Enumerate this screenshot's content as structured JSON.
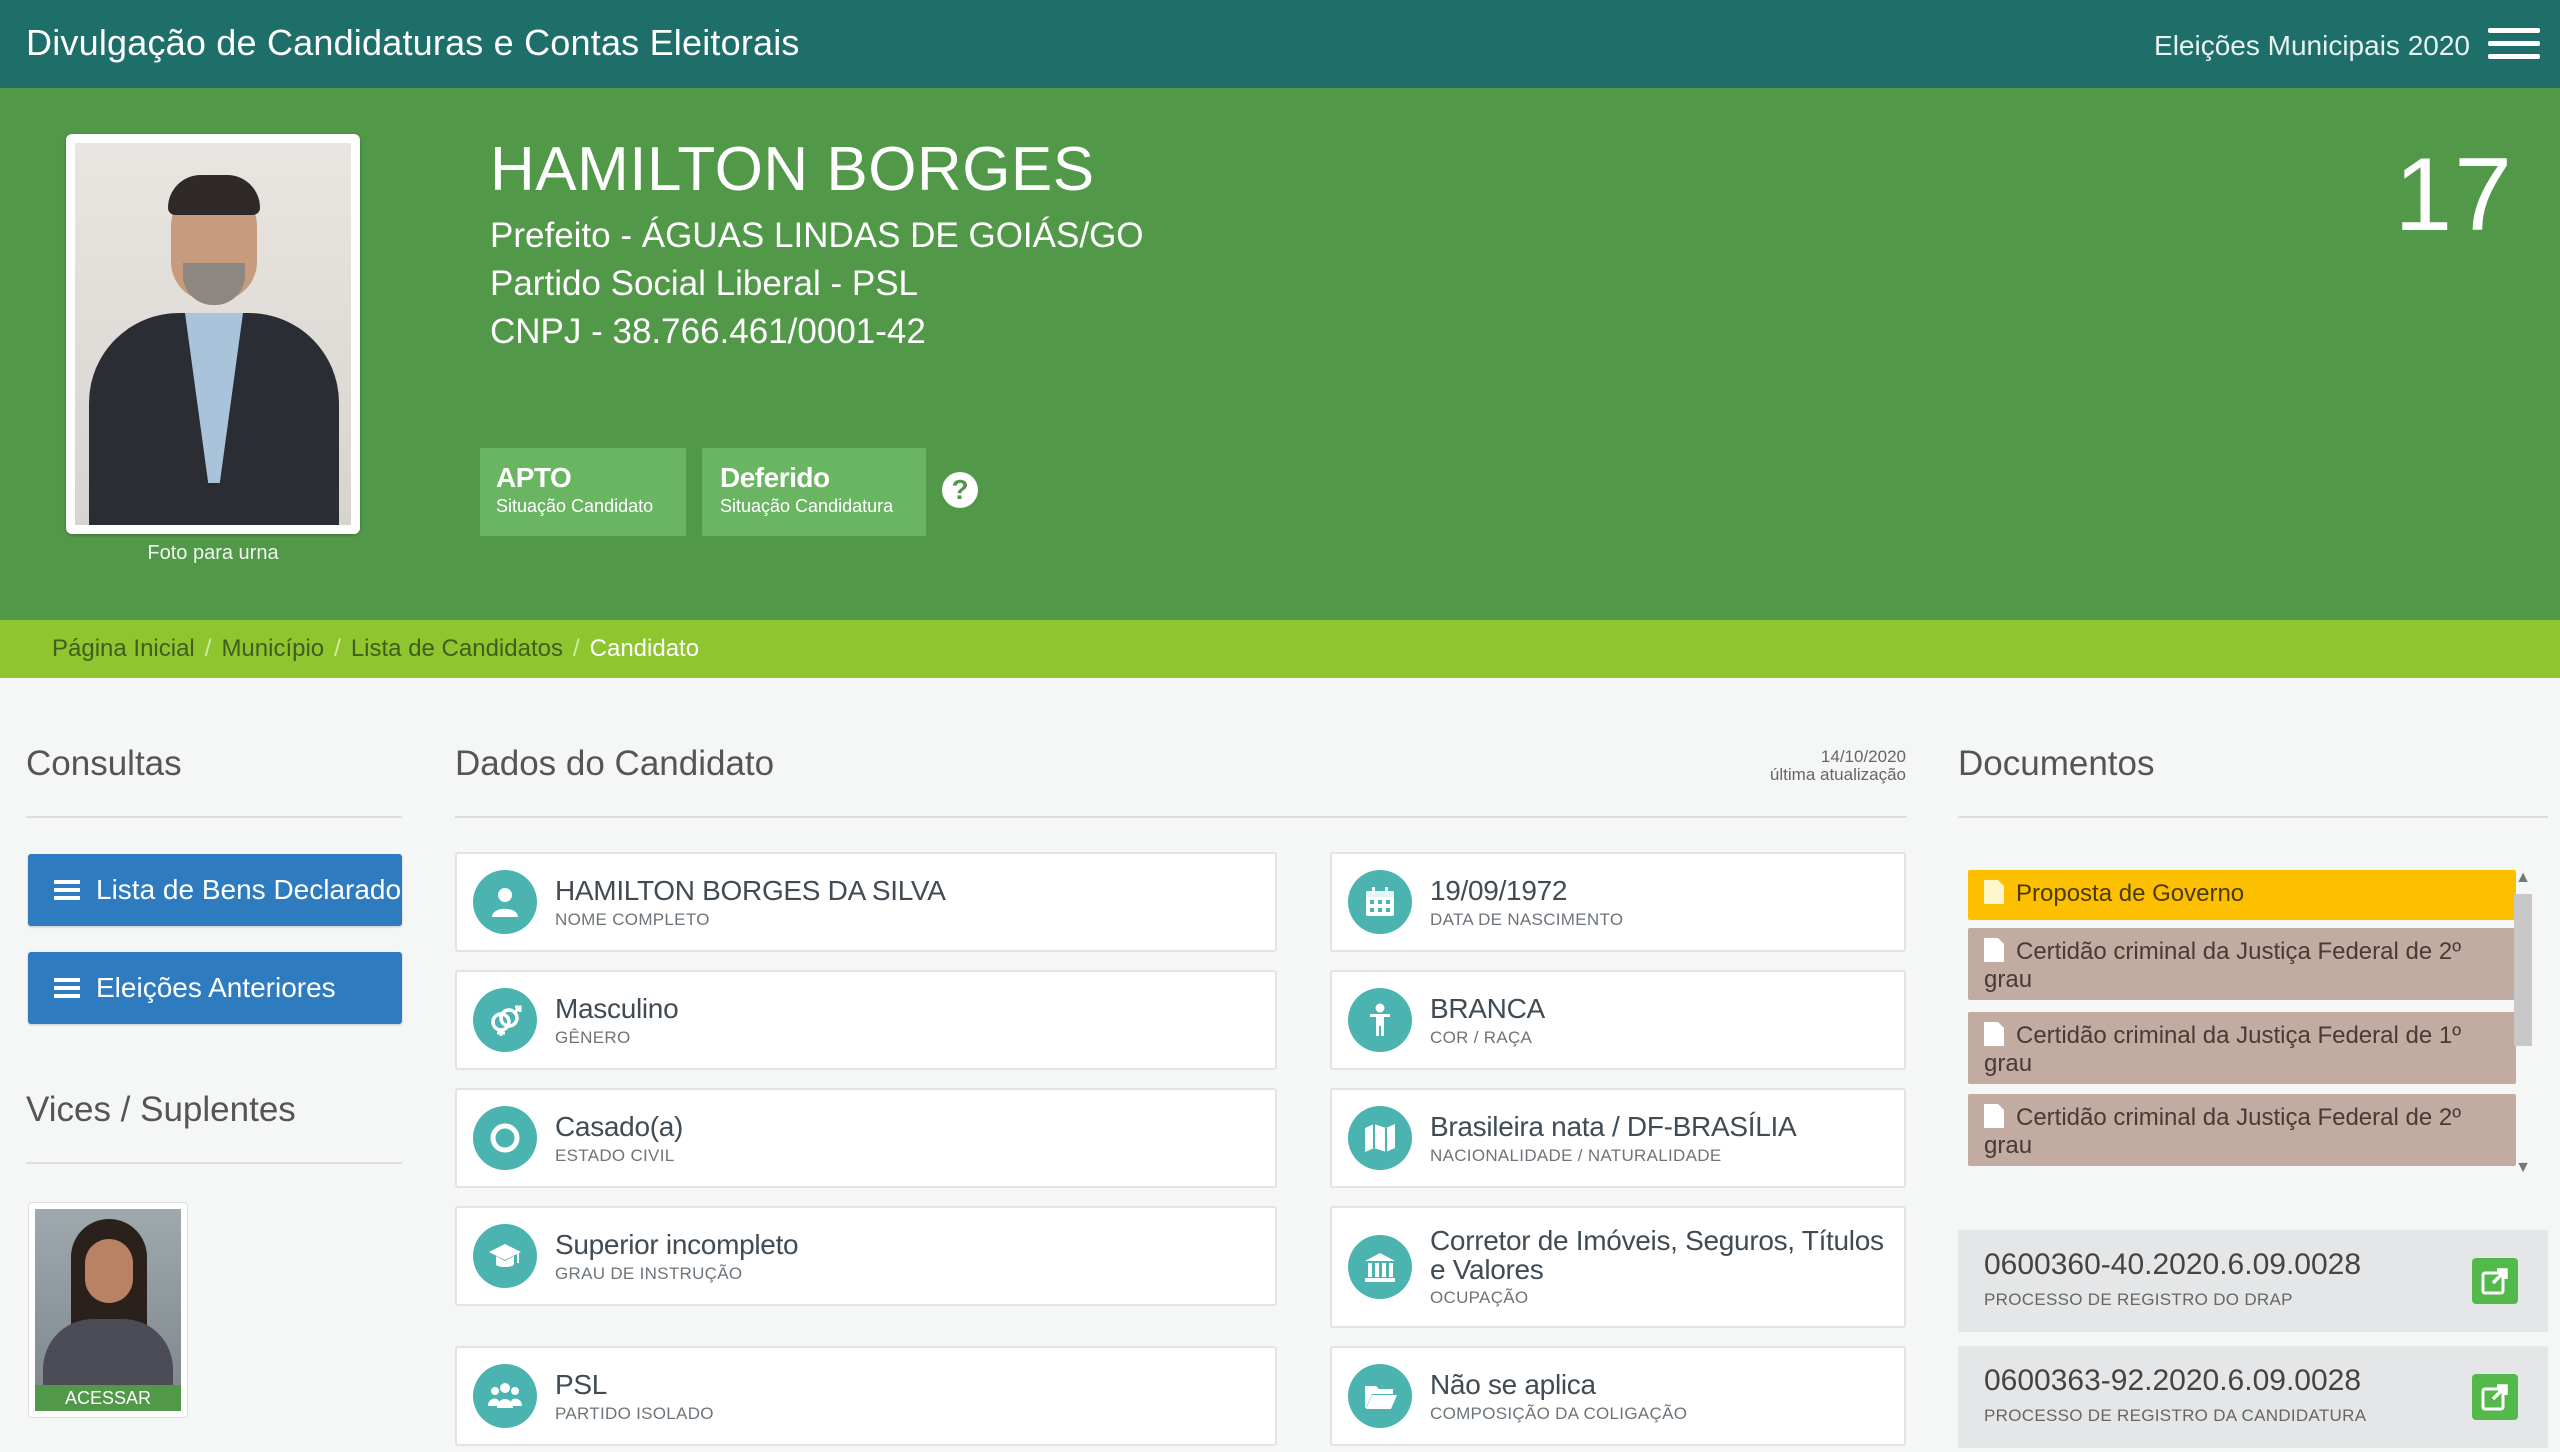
{
  "topbar": {
    "title": "Divulgação de Candidaturas e Contas Eleitorais",
    "election": "Eleições Municipais 2020"
  },
  "candidate": {
    "name": "HAMILTON BORGES",
    "office": "Prefeito - ÁGUAS LINDAS DE GOIÁS/GO",
    "party": "Partido Social Liberal - PSL",
    "cnpj": "CNPJ - 38.766.461/0001-42",
    "number": "17",
    "photo_caption": "Foto para urna",
    "status_candidate": {
      "value": "APTO",
      "label": "Situação Candidato"
    },
    "status_candidacy": {
      "value": "Deferido",
      "label": "Situação Candidatura"
    },
    "help": "?"
  },
  "breadcrumb": {
    "items": [
      "Página Inicial",
      "Município",
      "Lista de Candidatos"
    ],
    "current": "Candidato",
    "separator": "/"
  },
  "consultas": {
    "title": "Consultas",
    "buttons": [
      "Lista de Bens Declarados",
      "Eleições Anteriores"
    ]
  },
  "vices": {
    "title": "Vices / Suplentes",
    "access_label": "ACESSAR"
  },
  "dados": {
    "title": "Dados do Candidato",
    "update_date": "14/10/2020",
    "update_label": "última atualização",
    "fields": [
      {
        "value": "HAMILTON BORGES DA SILVA",
        "label": "NOME COMPLETO",
        "icon": "person-icon"
      },
      {
        "value": "19/09/1972",
        "label": "DATA DE NASCIMENTO",
        "icon": "calendar-icon"
      },
      {
        "value": "Masculino",
        "label": "GÊNERO",
        "icon": "gender-icon"
      },
      {
        "value": "BRANCA",
        "label": "COR / RAÇA",
        "icon": "figure-icon"
      },
      {
        "value": "Casado(a)",
        "label": "ESTADO CIVIL",
        "icon": "ring-icon"
      },
      {
        "value": "Brasileira nata / DF-BRASÍLIA",
        "label": "NACIONALIDADE / NATURALIDADE",
        "icon": "map-icon"
      },
      {
        "value": "Superior incompleto",
        "label": "GRAU DE INSTRUÇÃO",
        "icon": "graduation-icon"
      },
      {
        "value": "Corretor de Imóveis, Seguros, Títulos e Valores",
        "label": "OCUPAÇÃO",
        "icon": "institution-icon"
      },
      {
        "value": "PSL",
        "label": "PARTIDO ISOLADO",
        "icon": "group-icon"
      },
      {
        "value": "Não se aplica",
        "label": "COMPOSIÇÃO DA COLIGAÇÃO",
        "icon": "folder-icon"
      }
    ]
  },
  "documentos": {
    "title": "Documentos",
    "items": [
      {
        "label": "Proposta de Governo",
        "highlight": true
      },
      {
        "label": "Certidão criminal da Justiça Federal de 2º grau",
        "highlight": false
      },
      {
        "label": "Certidão criminal da Justiça Federal de 1º grau",
        "highlight": false
      },
      {
        "label": "Certidão criminal da Justiça Federal de 2º grau",
        "highlight": false
      }
    ],
    "processes": [
      {
        "number": "0600360-40.2020.6.09.0028",
        "label": "PROCESSO DE REGISTRO DO DRAP"
      },
      {
        "number": "0600363-92.2020.6.09.0028",
        "label": "PROCESSO DE REGISTRO DA CANDIDATURA"
      }
    ]
  },
  "colors": {
    "topbar": "#1e6e6a",
    "hero": "#529849",
    "breadcrumb": "#8fc630",
    "button_blue": "#2f7bbf",
    "icon_teal": "#4bb3b0",
    "doc_highlight": "#fcc000",
    "doc_normal": "#c2aba1"
  }
}
